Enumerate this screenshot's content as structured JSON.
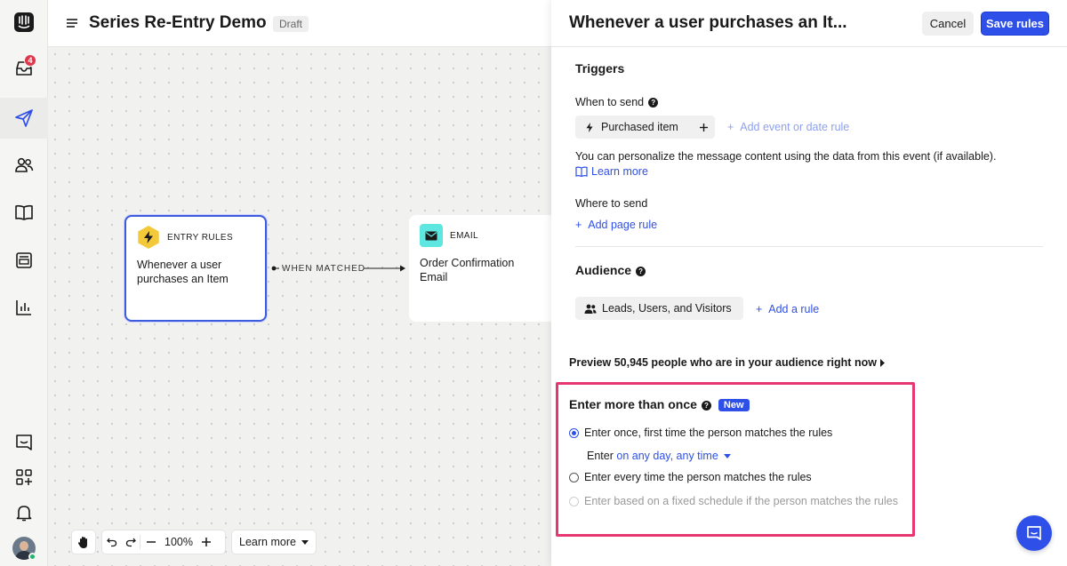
{
  "rail": {
    "inbox_badge": "4"
  },
  "header": {
    "title": "Series Re-Entry Demo",
    "status": "Draft"
  },
  "canvas": {
    "entry_node": {
      "kind": "ENTRY RULES",
      "text": "Whenever a user purchases an Item"
    },
    "edge_label": "WHEN MATCHED",
    "email_node": {
      "kind": "EMAIL",
      "text": "Order Confirmation Email"
    },
    "toolbar": {
      "zoom": "100%",
      "learn_more": "Learn more"
    }
  },
  "panel": {
    "title": "Whenever a user purchases an It...",
    "cancel_label": "Cancel",
    "save_label": "Save rules",
    "triggers": {
      "title": "Triggers",
      "when_to_send": "When to send",
      "event_chip": "Purchased item",
      "add_event_rule": "Add event or date rule",
      "personalize_note": "You can personalize the message content using the data from this event (if available).",
      "learn_more": "Learn more",
      "where_to_send": "Where to send",
      "add_page_rule": "Add page rule"
    },
    "audience": {
      "title": "Audience",
      "audience_chip": "Leads, Users, and Visitors",
      "add_rule": "Add a rule",
      "preview": "Preview 50,945 people who are in your audience right now"
    },
    "reentry": {
      "title": "Enter more than once",
      "new_badge": "New",
      "option_once": "Enter once, first time the person matches the rules",
      "enter_prefix": "Enter",
      "enter_timing": "on any day, any time",
      "option_every": "Enter every time the person matches the rules",
      "option_schedule": "Enter based on a fixed schedule if the person matches the rules"
    }
  },
  "colors": {
    "accent": "#2f50e8",
    "highlight": "#e83670"
  }
}
